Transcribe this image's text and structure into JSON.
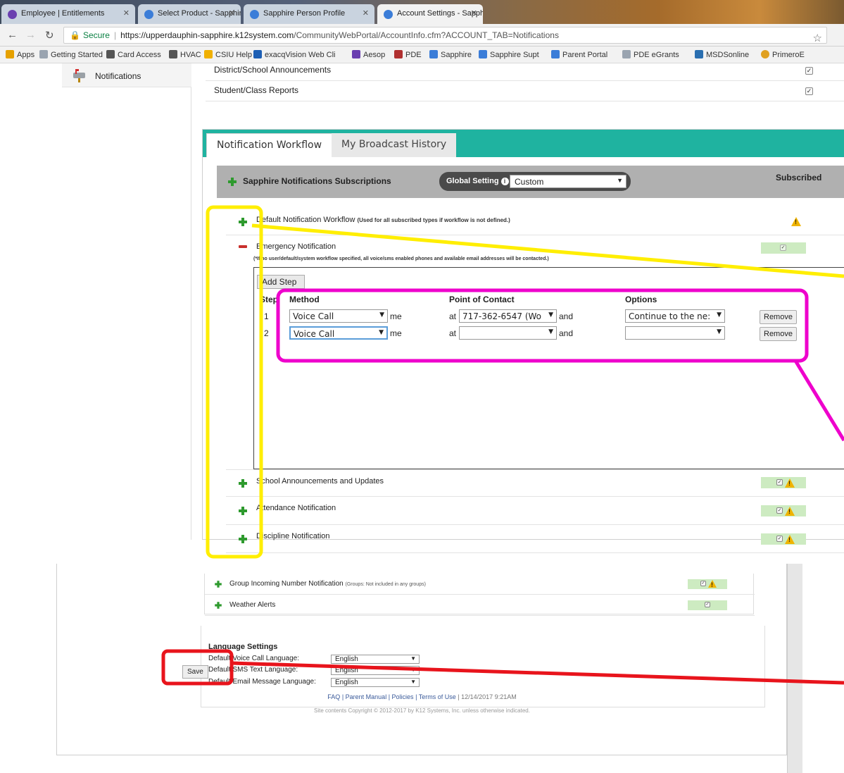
{
  "browser": {
    "tabs": [
      {
        "label": "Employee | Entitlements",
        "active": false,
        "fav_color": "#6a3fb0"
      },
      {
        "label": "Select Product - Sapphire",
        "active": false,
        "fav_color": "#3b7dd8"
      },
      {
        "label": "Sapphire Person Profile",
        "active": false,
        "fav_color": "#3b7dd8"
      },
      {
        "label": "Account Settings - Sapph",
        "active": true,
        "fav_color": "#3b7dd8"
      }
    ],
    "url_secure": "Secure",
    "url_host": "https://upperdauphin-sapphire.k12system.com",
    "url_path": "/CommunityWebPortal/AccountInfo.cfm?ACCOUNT_TAB=Notifications",
    "bookmarks": [
      {
        "label": "Apps",
        "color": "#e6a100"
      },
      {
        "label": "Getting Started",
        "color": "#9aa4b0"
      },
      {
        "label": "Card Access",
        "color": "#555555"
      },
      {
        "label": "HVAC",
        "color": "#555555"
      },
      {
        "label": "CSIU Help",
        "color": "#f0b000"
      },
      {
        "label": "exacqVision Web Cli",
        "color": "#1d5fb4"
      },
      {
        "label": "Aesop",
        "color": "#6a3fb0"
      },
      {
        "label": "PDE",
        "color": "#b03030"
      },
      {
        "label": "Sapphire",
        "color": "#3b7dd8"
      },
      {
        "label": "Sapphire Supt",
        "color": "#3b7dd8"
      },
      {
        "label": "Parent Portal",
        "color": "#3b7dd8"
      },
      {
        "label": "PDE eGrants",
        "color": "#9aa4b0"
      },
      {
        "label": "MSDSonline",
        "color": "#2a6fb0"
      },
      {
        "label": "PrimeroE",
        "color": "#e0a020"
      }
    ]
  },
  "sidebar": {
    "notifications_label": "Notifications"
  },
  "top_rows": [
    {
      "label": "District/School Announcements",
      "checked": true
    },
    {
      "label": "Student/Class Reports",
      "checked": true
    }
  ],
  "workflow_tabs": {
    "active": "Notification Workflow",
    "inactive": "My Broadcast History"
  },
  "subscriptions": {
    "title": "Sapphire Notifications Subscriptions",
    "global_label": "Global Setting",
    "global_value": "Custom",
    "subscribed_label": "Subscribed"
  },
  "types": {
    "default": {
      "label": "Default Notification Workflow",
      "note": "(Used for all subscribed types if workflow is not defined.)"
    },
    "emergency": {
      "label": "Emergency Notification",
      "note": "(*If no user/default/system workflow specified, all voice/sms enabled phones and available email addresses will be contacted.)"
    },
    "school": {
      "label": "School Announcements and Updates"
    },
    "attendance": {
      "label": "Attendance Notification"
    },
    "discipline": {
      "label": "Discipline Notification"
    }
  },
  "workflow": {
    "add_step": "Add Step",
    "headers": {
      "step": "Step",
      "method": "Method",
      "contact": "Point of Contact",
      "options": "Options"
    },
    "rows": [
      {
        "step": "1",
        "method": "Voice Call",
        "me": "me",
        "at": "at",
        "contact": "717-362-6547 (Wo",
        "and": "and",
        "option": "Continue to the ne:",
        "remove": "Remove"
      },
      {
        "step": "2",
        "method": "Voice Call",
        "me": "me",
        "at": "at",
        "contact": "",
        "and": "and",
        "option": "",
        "remove": "Remove"
      }
    ]
  },
  "bottom": {
    "group_label": "Group Incoming Number Notification",
    "group_note": "(Groups: Not included in any groups)",
    "weather_label": "Weather Alerts",
    "language_title": "Language Settings",
    "languages": [
      {
        "label": "Default Voice Call Language:",
        "value": "English"
      },
      {
        "label": "Default SMS Text Language:",
        "value": "English"
      },
      {
        "label": "Default Email Message Language:",
        "value": "English"
      }
    ],
    "save": "Save",
    "footer_links": [
      "FAQ",
      "Parent Manual",
      "Policies",
      "Terms of Use"
    ],
    "footer_date": "12/14/2017 9:21AM",
    "copyright": "Site contents Copyright © 2012-2017 by K12 Systems, Inc. unless otherwise indicated."
  },
  "colors": {
    "accent_teal": "#1fb3a0",
    "annotation_yellow": "#ffee00",
    "annotation_magenta": "#ee00cc",
    "annotation_red": "#e8141c",
    "subscribed_green": "#cdebc1"
  }
}
